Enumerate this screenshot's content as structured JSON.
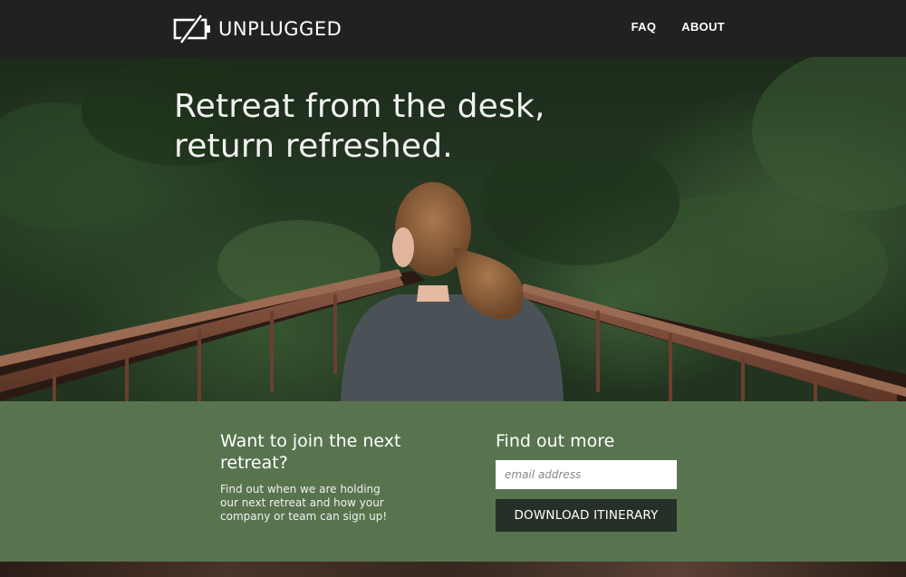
{
  "brand": {
    "name": "UNPLUGGED",
    "logo_icon": "unplugged-battery-icon"
  },
  "nav": {
    "items": [
      {
        "label": "FAQ"
      },
      {
        "label": "ABOUT"
      }
    ]
  },
  "hero": {
    "line1": "Retreat from the desk,",
    "line2": "return refreshed.",
    "image": "woman-on-forest-bridge"
  },
  "cta": {
    "heading": "Want to join the next retreat?",
    "text": "Find out when we are holding our next retreat and how your company or team can sign up!",
    "form_heading": "Find out more",
    "email_placeholder": "email address",
    "button_label": "DOWNLOAD ITINERARY"
  },
  "colors": {
    "topbar": "#212121",
    "cta_background": "#58744f",
    "button_background": "#263029"
  }
}
